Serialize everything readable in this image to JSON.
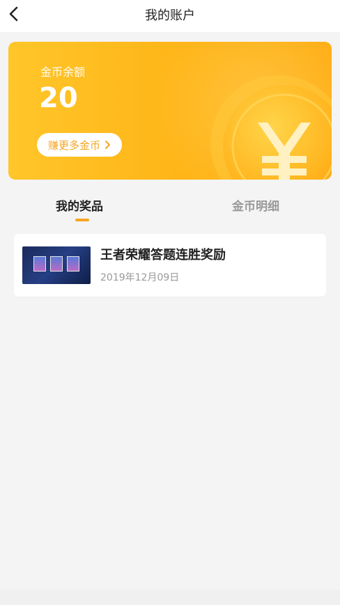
{
  "nav": {
    "title": "我的账户",
    "back_icon": "chevron-left-icon"
  },
  "balance": {
    "label": "金币余额",
    "value": "20",
    "earn_button": "赚更多金币",
    "earn_button_icon": "chevron-right-icon",
    "coin_icon": "yen-coin-icon"
  },
  "tabs": [
    {
      "label": "我的奖品",
      "active": true
    },
    {
      "label": "金币明细",
      "active": false
    }
  ],
  "prizes": [
    {
      "name": "王者荣耀答题连胜奖励",
      "date": "2019年12月09日"
    }
  ],
  "colors": {
    "accent": "#f5a623",
    "card_gradient_start": "#ffc62a",
    "card_gradient_end": "#ffab10",
    "background": "#f4f4f4"
  }
}
